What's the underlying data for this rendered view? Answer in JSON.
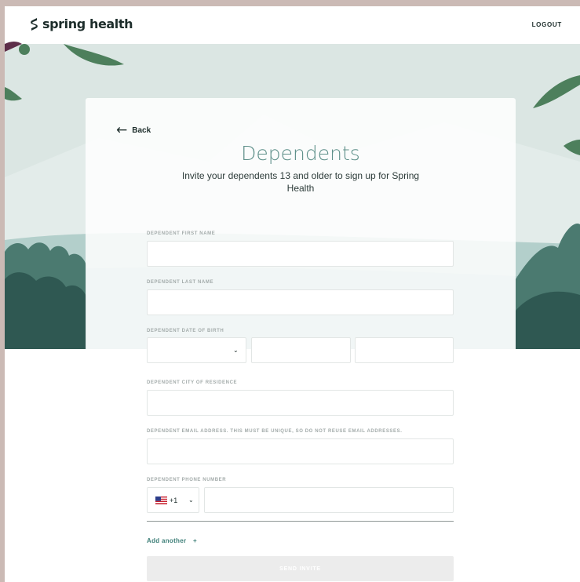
{
  "brand": {
    "name": "spring health",
    "accent": "#5d8f89",
    "link_color": "#3e7f78"
  },
  "header": {
    "logout_label": "LOGOUT"
  },
  "page": {
    "back_label": "Back",
    "title": "Dependents",
    "subtitle": "Invite your dependents 13 and older to sign up for Spring Health"
  },
  "form": {
    "first_name": {
      "label": "DEPENDENT FIRST NAME",
      "value": ""
    },
    "last_name": {
      "label": "DEPENDENT LAST NAME",
      "value": ""
    },
    "dob": {
      "label": "DEPENDENT DATE OF BIRTH",
      "month": "",
      "day": "",
      "year": ""
    },
    "city": {
      "label": "DEPENDENT CITY OF RESIDENCE",
      "value": ""
    },
    "email": {
      "label": "DEPENDENT EMAIL ADDRESS.  THIS MUST BE UNIQUE, SO DO NOT REUSE EMAIL ADDRESSES.",
      "value": ""
    },
    "phone": {
      "label": "DEPENDENT PHONE NUMBER",
      "country_icon": "us-flag-icon",
      "dial_code": "+1",
      "value": ""
    },
    "add_another_label": "Add another",
    "add_icon": "+",
    "send_label": "SEND INVITE"
  }
}
